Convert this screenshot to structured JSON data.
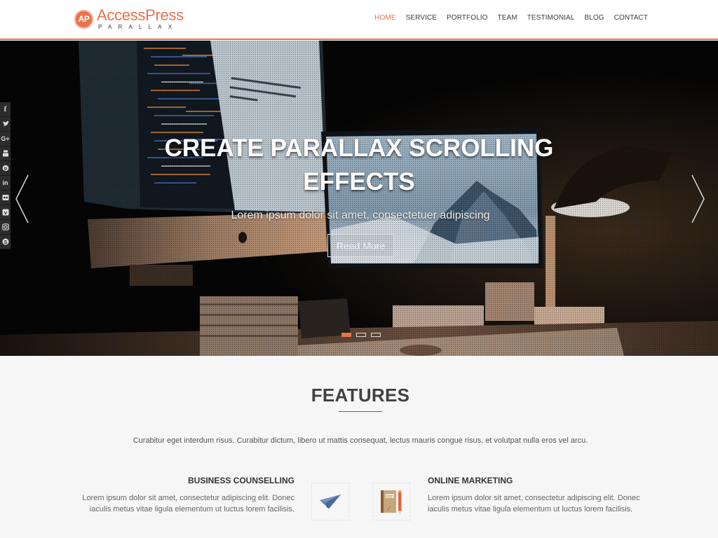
{
  "header": {
    "logo_badge": "AP",
    "logo_title": "AccessPress",
    "logo_subtitle": "PARALLAX",
    "nav": [
      {
        "label": "HOME",
        "active": true
      },
      {
        "label": "SERVICE",
        "active": false
      },
      {
        "label": "PORTFOLIO",
        "active": false
      },
      {
        "label": "TEAM",
        "active": false
      },
      {
        "label": "TESTIMONIAL",
        "active": false
      },
      {
        "label": "BLOG",
        "active": false
      },
      {
        "label": "CONTACT",
        "active": false
      }
    ]
  },
  "hero": {
    "title_line1": "CREATE PARALLAX SCROLLING",
    "title_line2": "EFFECTS",
    "subtitle": "Lorem ipsum dolor sit amet, consectetuer adipiscing",
    "button_label": "Read More",
    "slides_total": 3,
    "active_slide": 1,
    "prev_icon": "chevron-left-icon",
    "next_icon": "chevron-right-icon"
  },
  "social": [
    {
      "name": "facebook",
      "glyph": "f"
    },
    {
      "name": "twitter",
      "glyph": "t"
    },
    {
      "name": "google-plus",
      "glyph": "G+"
    },
    {
      "name": "youtube",
      "glyph": "yt"
    },
    {
      "name": "pinterest",
      "glyph": "p"
    },
    {
      "name": "linkedin",
      "glyph": "in"
    },
    {
      "name": "flickr",
      "glyph": "••"
    },
    {
      "name": "vimeo",
      "glyph": "v"
    },
    {
      "name": "instagram",
      "glyph": "ig"
    },
    {
      "name": "skype",
      "glyph": "S"
    }
  ],
  "features": {
    "title": "FEATURES",
    "description": "Curabitur eget interdum risus. Curabitur dictum, libero ut mattis consequat, lectus mauris congue risus, et volutpat nulla eros vel arcu.",
    "items": [
      {
        "title": "BUSINESS COUNSELLING",
        "text": "Lorem ipsum dolor sit amet, consectetur adipiscing elit. Donec iaculis metus vitae ligula elementum ut luctus lorem facilisis.",
        "icon": "paper-plane-icon"
      },
      {
        "title": "ONLINE MARKETING",
        "text": "Lorem ipsum dolor sit amet, consectetur adipiscing elit. Donec iaculis metus vitae ligula elementum ut luctus lorem facilisis.",
        "icon": "notebook-pencil-icon"
      }
    ]
  },
  "colors": {
    "accent": "#e8734a",
    "text_dark": "#333333",
    "background": "#f6f6f6"
  }
}
